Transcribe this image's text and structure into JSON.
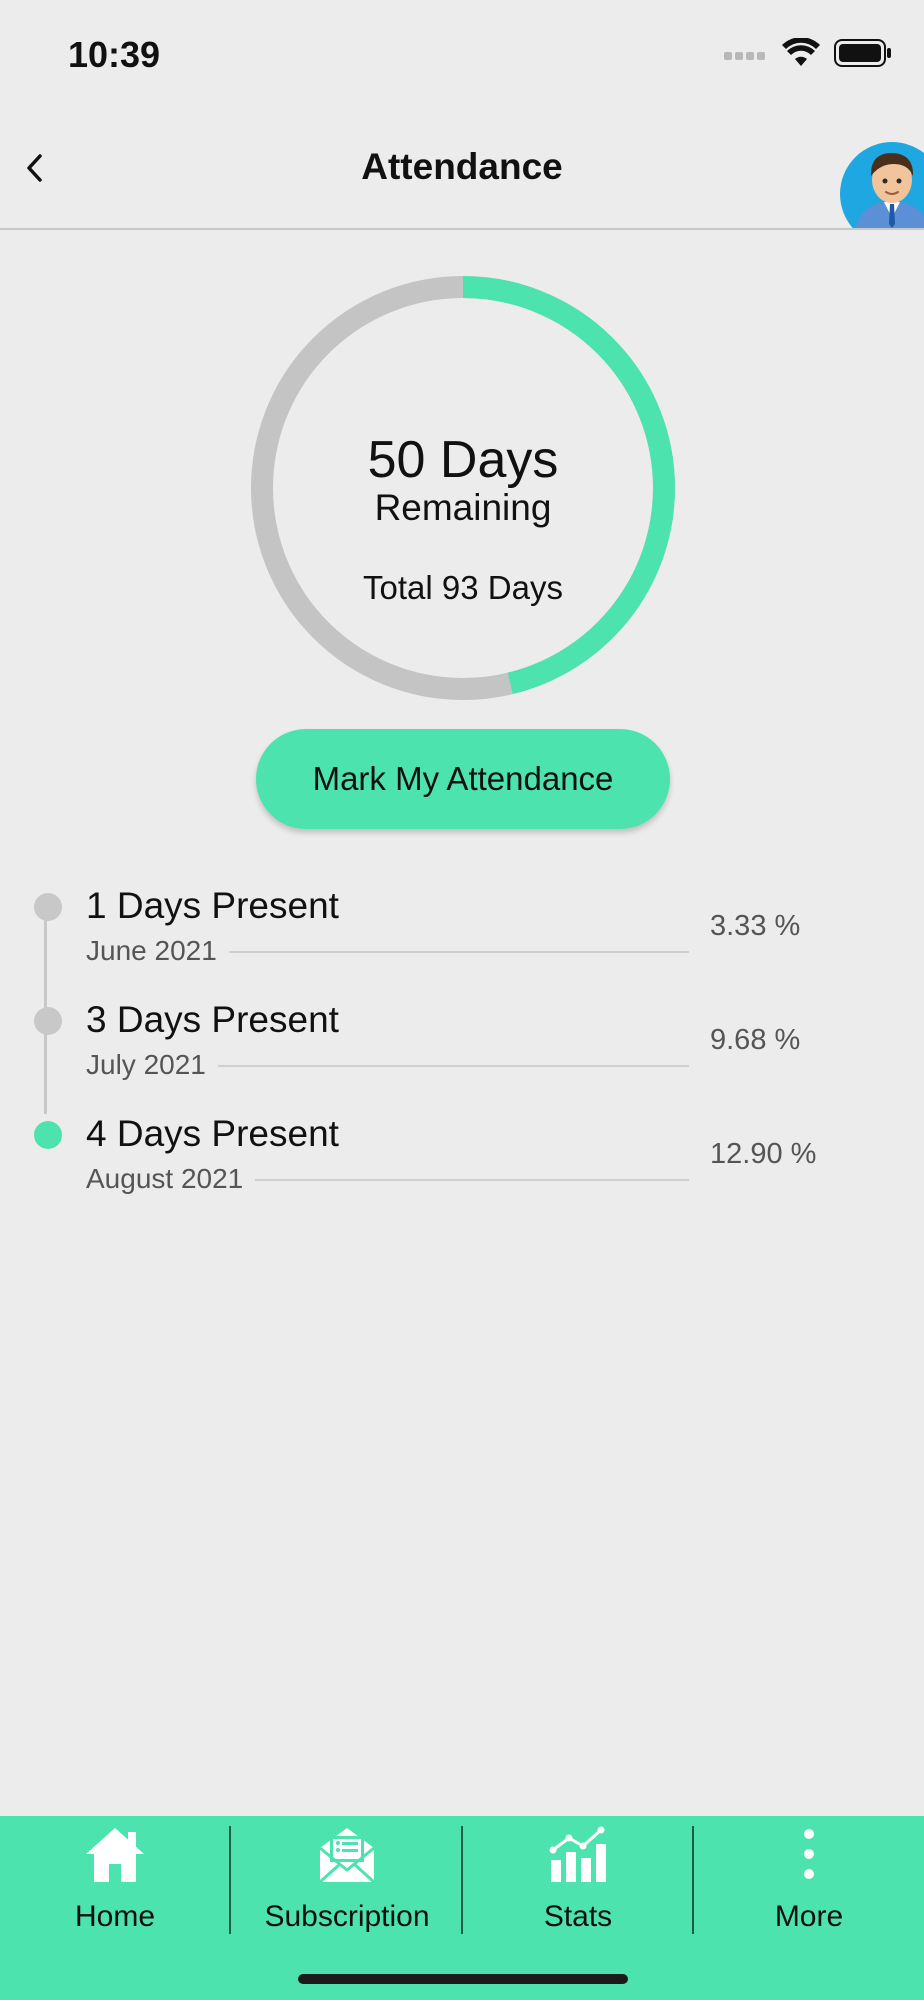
{
  "status_bar": {
    "time": "10:39",
    "icons": [
      "cellular-icon",
      "wifi-icon",
      "battery-icon"
    ]
  },
  "header": {
    "title": "Attendance",
    "back_icon": "chevron-left-icon",
    "avatar": "user-avatar"
  },
  "summary": {
    "days_remaining": "50 Days",
    "remaining_label": "Remaining",
    "total_days": "Total 93 Days",
    "progress_fraction": 0.462,
    "progress_color": "#4de3ae",
    "track_color": "#c4c4c4"
  },
  "action": {
    "mark_label": "Mark My Attendance"
  },
  "timeline": {
    "items": [
      {
        "title": "1 Days Present",
        "month": "June 2021",
        "percent": "3.33 %",
        "active": false
      },
      {
        "title": "3 Days Present",
        "month": "July 2021",
        "percent": "9.68 %",
        "active": false
      },
      {
        "title": "4 Days Present",
        "month": "August 2021",
        "percent": "12.90 %",
        "active": true
      }
    ]
  },
  "tabs": [
    {
      "label": "Home",
      "icon": "home-icon"
    },
    {
      "label": "Subscription",
      "icon": "mail-icon"
    },
    {
      "label": "Stats",
      "icon": "stats-icon"
    },
    {
      "label": "More",
      "icon": "more-vertical-icon"
    }
  ],
  "colors": {
    "accent": "#4de3ae",
    "background": "#ececec",
    "inactive_dot": "#c8c8c8"
  }
}
